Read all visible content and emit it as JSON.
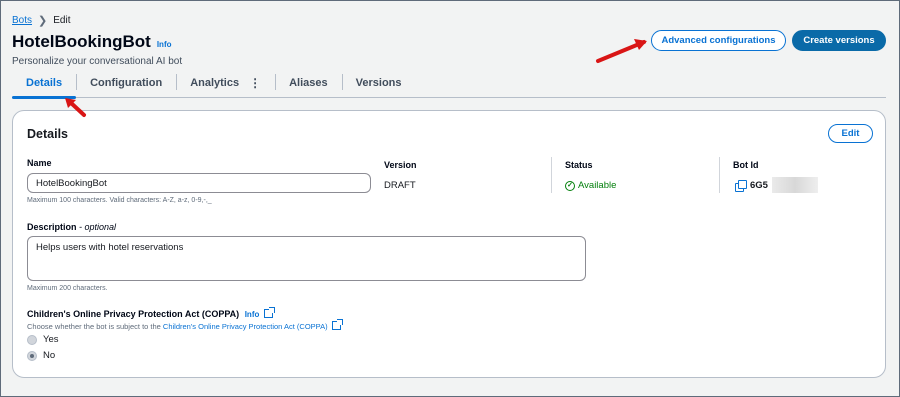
{
  "breadcrumb": {
    "parent": "Bots",
    "current": "Edit"
  },
  "header": {
    "title": "HotelBookingBot",
    "info": "Info",
    "subtitle": "Personalize your conversational AI bot"
  },
  "actions": {
    "advanced": "Advanced configurations",
    "create": "Create versions"
  },
  "tabs": [
    "Details",
    "Configuration",
    "Analytics",
    "Aliases",
    "Versions"
  ],
  "active_tab": "Details",
  "details": {
    "title": "Details",
    "edit": "Edit",
    "name": {
      "label": "Name",
      "value": "HotelBookingBot",
      "hint": "Maximum 100 characters. Valid characters: A-Z, a-z, 0-9,-,_"
    },
    "version": {
      "label": "Version",
      "value": "DRAFT"
    },
    "status": {
      "label": "Status",
      "value": "Available"
    },
    "bot_id": {
      "label": "Bot Id",
      "value": "6G5"
    },
    "description": {
      "label": "Description",
      "optional": "- optional",
      "value": "Helps users  with hotel reservations",
      "hint": "Maximum 200 characters."
    },
    "coppa": {
      "label": "Children's Online Privacy Protection Act (COPPA)",
      "info": "Info",
      "desc_prefix": "Choose whether the bot is subject to the ",
      "desc_link": "Children's Online Privacy Protection Act (COPPA)",
      "options": [
        "Yes",
        "No"
      ],
      "selected": "No"
    }
  },
  "colors": {
    "accent": "#0972d3",
    "success": "#037f0c",
    "annotation": "#d91515"
  }
}
